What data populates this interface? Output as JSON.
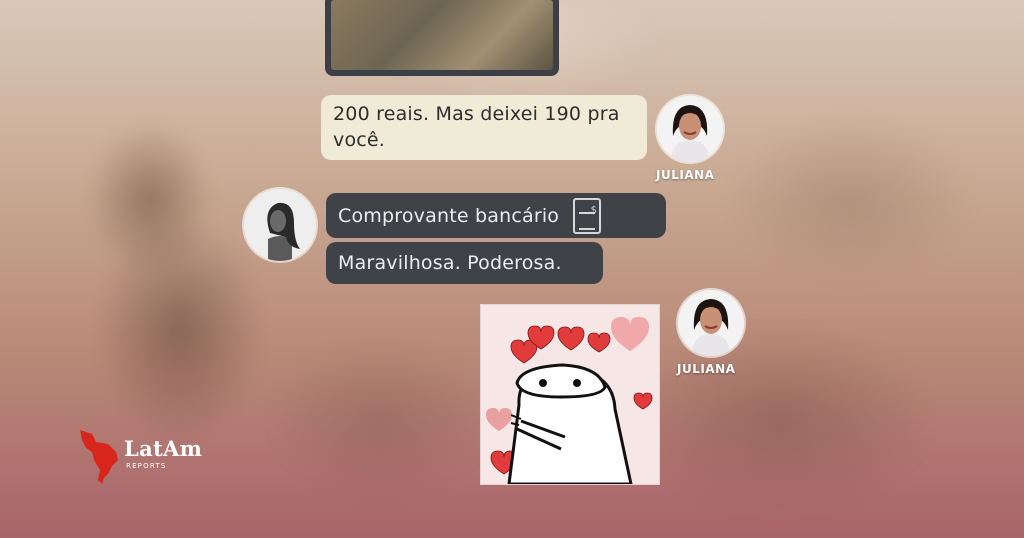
{
  "messages": {
    "juliana_amount": "200 reais. Mas deixei 190 pra você.",
    "receipt": "Comprovante bancário",
    "praise": "Maravilhosa. Poderosa."
  },
  "contacts": {
    "juliana_label": "JULIANA",
    "juliana_label_2": "JULIANA"
  },
  "icons": {
    "receipt": "receipt-icon"
  },
  "logo": {
    "title": "LatAm",
    "subtitle": "REPORTS"
  },
  "colors": {
    "light_bubble": "#efebd6",
    "dark_bubble": "#3f4247",
    "logo_red": "#d9261c"
  }
}
